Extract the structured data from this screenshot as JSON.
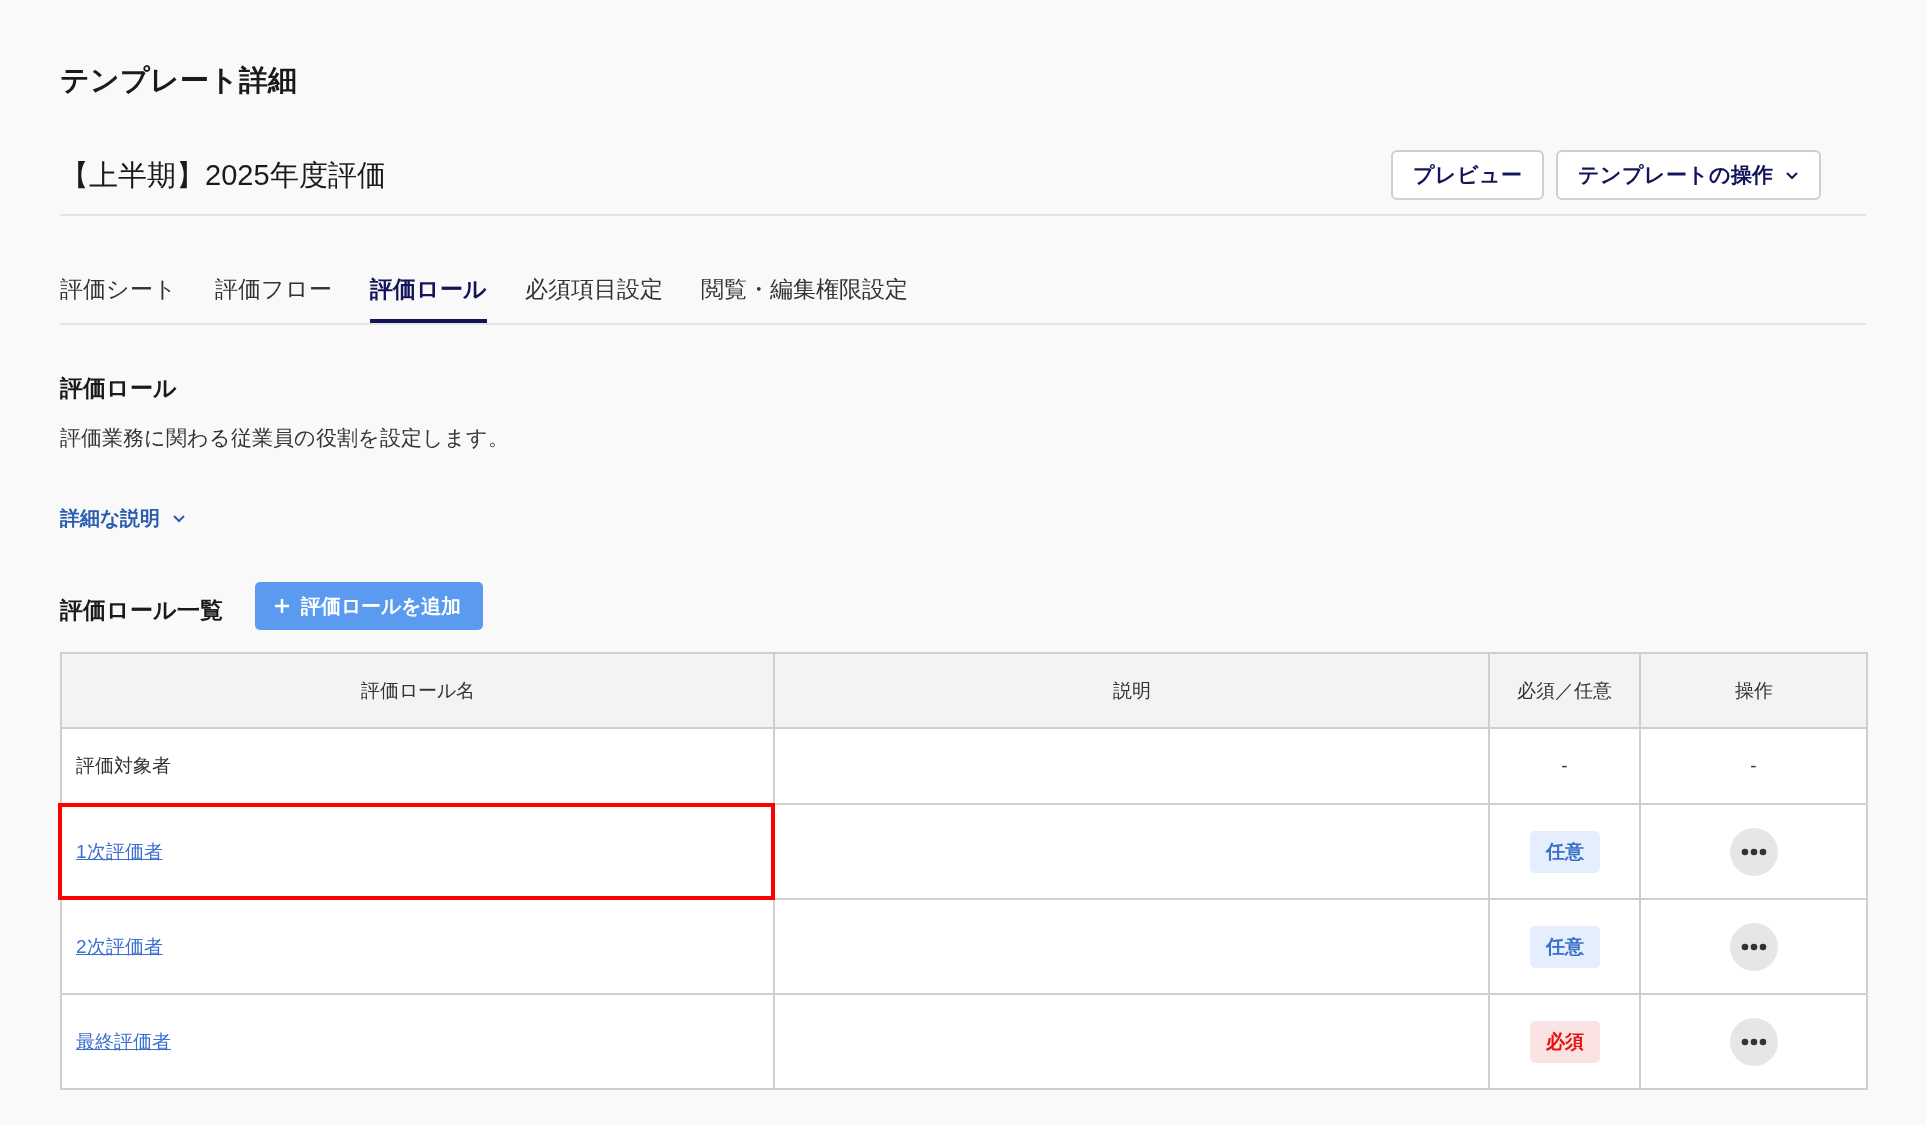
{
  "page_title": "テンプレート詳細",
  "template": {
    "name": "【上半期】2025年度評価",
    "buttons": [
      {
        "label": "プレビュー",
        "kind": "plain"
      },
      {
        "label": "テンプレートの操作",
        "kind": "dropdown"
      }
    ]
  },
  "tabs": [
    {
      "label": "評価シート",
      "selected": false
    },
    {
      "label": "評価フロー",
      "selected": false
    },
    {
      "label": "評価ロール",
      "selected": true
    },
    {
      "label": "必須項目設定",
      "selected": false
    },
    {
      "label": "閲覧・編集権限設定",
      "selected": false
    }
  ],
  "section": {
    "title": "評価ロール",
    "description": "評価業務に関わる従業員の役割を設定します。",
    "details_link": {
      "label": "詳細な説明",
      "expanded": false
    }
  },
  "list": {
    "title": "評価ロール一覧",
    "add_button": "評価ロールを追加"
  },
  "table": {
    "columns": [
      "評価ロール名",
      "説明",
      "必須／任意",
      "操作"
    ],
    "rows": [
      {
        "name": "評価対象者",
        "link": false,
        "highlighted": false,
        "requirement": {
          "kind": "none",
          "text": "-"
        },
        "action": {
          "kind": "text",
          "text": "-"
        }
      },
      {
        "name": "1次評価者",
        "link": true,
        "highlighted": true,
        "requirement": {
          "kind": "optional",
          "text": "任意"
        },
        "action": {
          "kind": "menu"
        }
      },
      {
        "name": "2次評価者",
        "link": true,
        "highlighted": false,
        "requirement": {
          "kind": "optional",
          "text": "任意"
        },
        "action": {
          "kind": "menu"
        }
      },
      {
        "name": "最終評価者",
        "link": true,
        "highlighted": false,
        "requirement": {
          "kind": "required",
          "text": "必須"
        },
        "action": {
          "kind": "menu"
        }
      }
    ]
  }
}
